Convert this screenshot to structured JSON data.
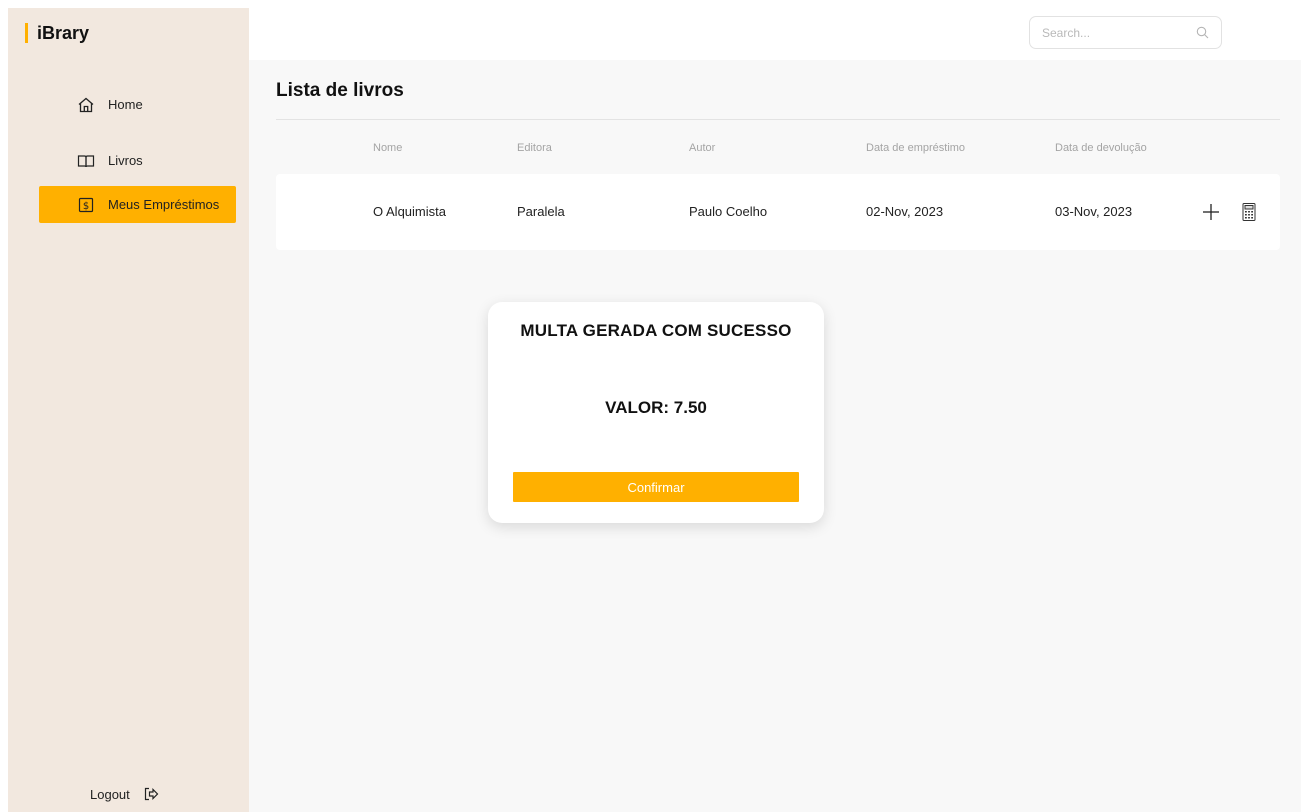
{
  "app": {
    "logo_text": "iBrary"
  },
  "sidebar": {
    "items": [
      {
        "label": "Home",
        "icon": "home-icon"
      },
      {
        "label": "Livros",
        "icon": "book-icon"
      },
      {
        "label": "Meus Empréstimos",
        "icon": "dollar-icon",
        "active": true
      }
    ],
    "logout_label": "Logout"
  },
  "search": {
    "placeholder": "Search...",
    "value": ""
  },
  "page": {
    "title": "Lista de livros"
  },
  "table": {
    "columns": [
      "Nome",
      "Editora",
      "Autor",
      "Data de empréstimo",
      "Data de devolução"
    ],
    "rows": [
      {
        "nome": "O Alquimista",
        "editora": "Paralela",
        "autor": "Paulo Coelho",
        "emprestimo": "02-Nov, 2023",
        "devolucao": "03-Nov, 2023"
      }
    ]
  },
  "modal": {
    "title": "MULTA GERADA COM SUCESSO",
    "value": "VALOR: 7.50",
    "button_label": "Confirmar"
  },
  "colors": {
    "accent": "#ffb000",
    "sidebar_bg": "#f2e8df",
    "main_bg": "#f8f8f8"
  }
}
